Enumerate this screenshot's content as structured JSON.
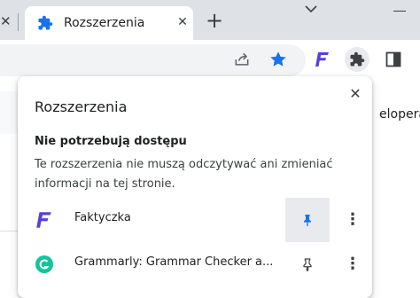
{
  "tabs": [
    {
      "title": "Rozszerzenia",
      "icon": "puzzle-icon"
    }
  ],
  "toolbar": {
    "icons": [
      "share-icon",
      "bookmark-star-icon",
      "faktyczka-icon",
      "extensions-puzzle-icon",
      "side-panel-icon"
    ]
  },
  "page": {
    "partial_text": "eloperai"
  },
  "popup": {
    "title": "Rozszerzenia",
    "section_heading": "Nie potrzebują dostępu",
    "section_description": "Te rozszerzenia nie muszą odczytywać ani zmieniać informacji na tej stronie.",
    "extensions": [
      {
        "name": "Faktyczka",
        "pinned": true,
        "icon": "faktyczka-icon"
      },
      {
        "name": "Grammarly: Grammar Checker a...",
        "pinned": false,
        "icon": "grammarly-icon"
      }
    ]
  },
  "colors": {
    "accent": "#1a73e8",
    "faktyczka": "#5b3fd6",
    "grammarly": "#15c39a"
  }
}
